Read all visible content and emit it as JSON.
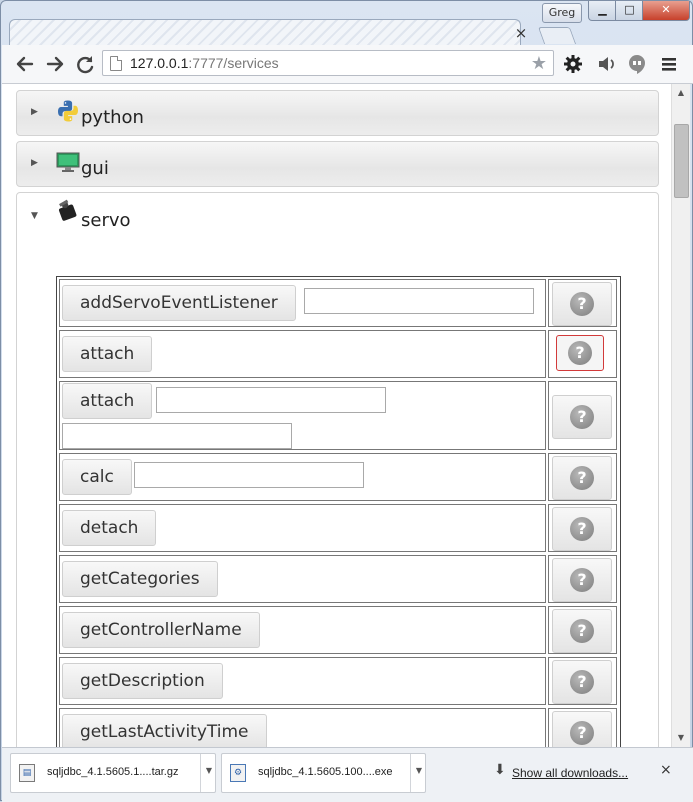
{
  "window": {
    "user": "Greg",
    "minimize": "▁",
    "maximize": "□",
    "close": "✕"
  },
  "tab": {
    "close": "×"
  },
  "toolbar": {
    "back_icon": "arrow-left",
    "forward_icon": "arrow-right",
    "reload_icon": "reload",
    "url_host": "127.0.0.1",
    "url_path": ":7777/services",
    "settings_icon": "gear",
    "speaker_icon": "speaker",
    "hangouts_icon": "hangouts",
    "menu_icon": "hamburger"
  },
  "accordion": [
    {
      "label": "python",
      "expanded": false
    },
    {
      "label": "gui",
      "expanded": false
    },
    {
      "label": "servo",
      "expanded": true
    }
  ],
  "methods": [
    {
      "name": "addServoEventListener"
    },
    {
      "name": "attach"
    },
    {
      "name": "attach"
    },
    {
      "name": "calc"
    },
    {
      "name": "detach"
    },
    {
      "name": "getCategories"
    },
    {
      "name": "getControllerName"
    },
    {
      "name": "getDescription"
    },
    {
      "name": "getLastActivityTime"
    }
  ],
  "help_symbol": "?",
  "downloads": {
    "items": [
      {
        "name": "sqljdbc_4.1.5605.1....tar.gz"
      },
      {
        "name": "sqljdbc_4.1.5605.100....exe"
      }
    ],
    "show_all": "Show all downloads...",
    "close": "×"
  },
  "colors": {
    "focus_border": "#d23a3a",
    "gui_icon": "#2a9a5c",
    "python_blue": "#3a6fb0",
    "python_yellow": "#f2cc3a"
  }
}
